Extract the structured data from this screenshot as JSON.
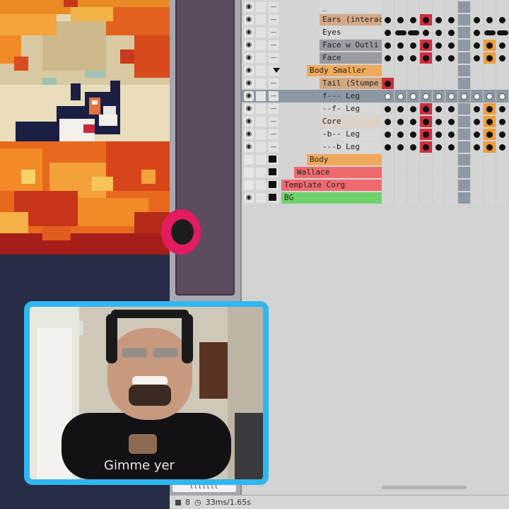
{
  "layers": [
    {
      "name": "_",
      "indent": 1,
      "color": "#d8d8d8",
      "eye": true
    },
    {
      "name": "Ears (interac",
      "indent": 1,
      "color": "#d7a887",
      "eye": true
    },
    {
      "name": "Eyes",
      "indent": 1,
      "color": "#d8d8d8",
      "eye": true
    },
    {
      "name": "Face w Outli",
      "indent": 1,
      "color": "#9a9aa3",
      "eye": true
    },
    {
      "name": "Face",
      "indent": 1,
      "color": "#9a9aa3",
      "eye": true
    },
    {
      "name": "Body Smaller",
      "indent": 0,
      "color": "#f0a95a",
      "eye": true,
      "group": "open"
    },
    {
      "name": "Tail (Stumpe",
      "indent": 1,
      "color": "#d2a780",
      "eye": true
    },
    {
      "name": "f--- Leg",
      "indent": 1,
      "color": "#8c97a4",
      "eye": true,
      "selected": true
    },
    {
      "name": "--f- Leg",
      "indent": 1,
      "color": "#d8d8d8",
      "eye": true
    },
    {
      "name": "Core",
      "indent": 1,
      "color": "#dcd2c8",
      "eye": true
    },
    {
      "name": "-b-- Leg",
      "indent": 1,
      "color": "#d8d8d8",
      "eye": true
    },
    {
      "name": "---b Leg",
      "indent": 1,
      "color": "#d8d8d8",
      "eye": true
    },
    {
      "name": "Body",
      "indent": 0,
      "color": "#f0a95a",
      "eye": false,
      "group": "closed"
    },
    {
      "name": "Wallace",
      "indent": -1,
      "color": "#ef6a6f",
      "eye": false,
      "group": "closed"
    },
    {
      "name": "Template Corg",
      "indent": -2,
      "color": "#ef6a6f",
      "eye": false,
      "group": "closed"
    },
    {
      "name": "BG",
      "indent": -2,
      "color": "#6fd16b",
      "eye": true,
      "group": "closed"
    }
  ],
  "cels": [
    "..........",
    "oooRoo.ooo",
    "o--ooo.o--",
    "oooRoo.oOo",
    "oooRoo.oOo",
    "..........",
    "R.........",
    "WWWWWWWWWW",
    "oooRoo.oOo",
    "oooRoo.oOo",
    "oooRoo.oOo",
    "oooRoo.oOo",
    "..........",
    "..........",
    "..........",
    ".........."
  ],
  "colors": {
    "accent_red": "#e31c5f",
    "webcam_border": "#2fb7ef",
    "cel_dot": "#111111",
    "cel_red": "#d12d3d",
    "cel_orange": "#ef9d3a"
  },
  "status": {
    "frame": "8",
    "timing": "33ms/1.65s"
  },
  "mini_label": "lllllll",
  "webcam": {
    "shirt_text": "Gimme yer"
  }
}
